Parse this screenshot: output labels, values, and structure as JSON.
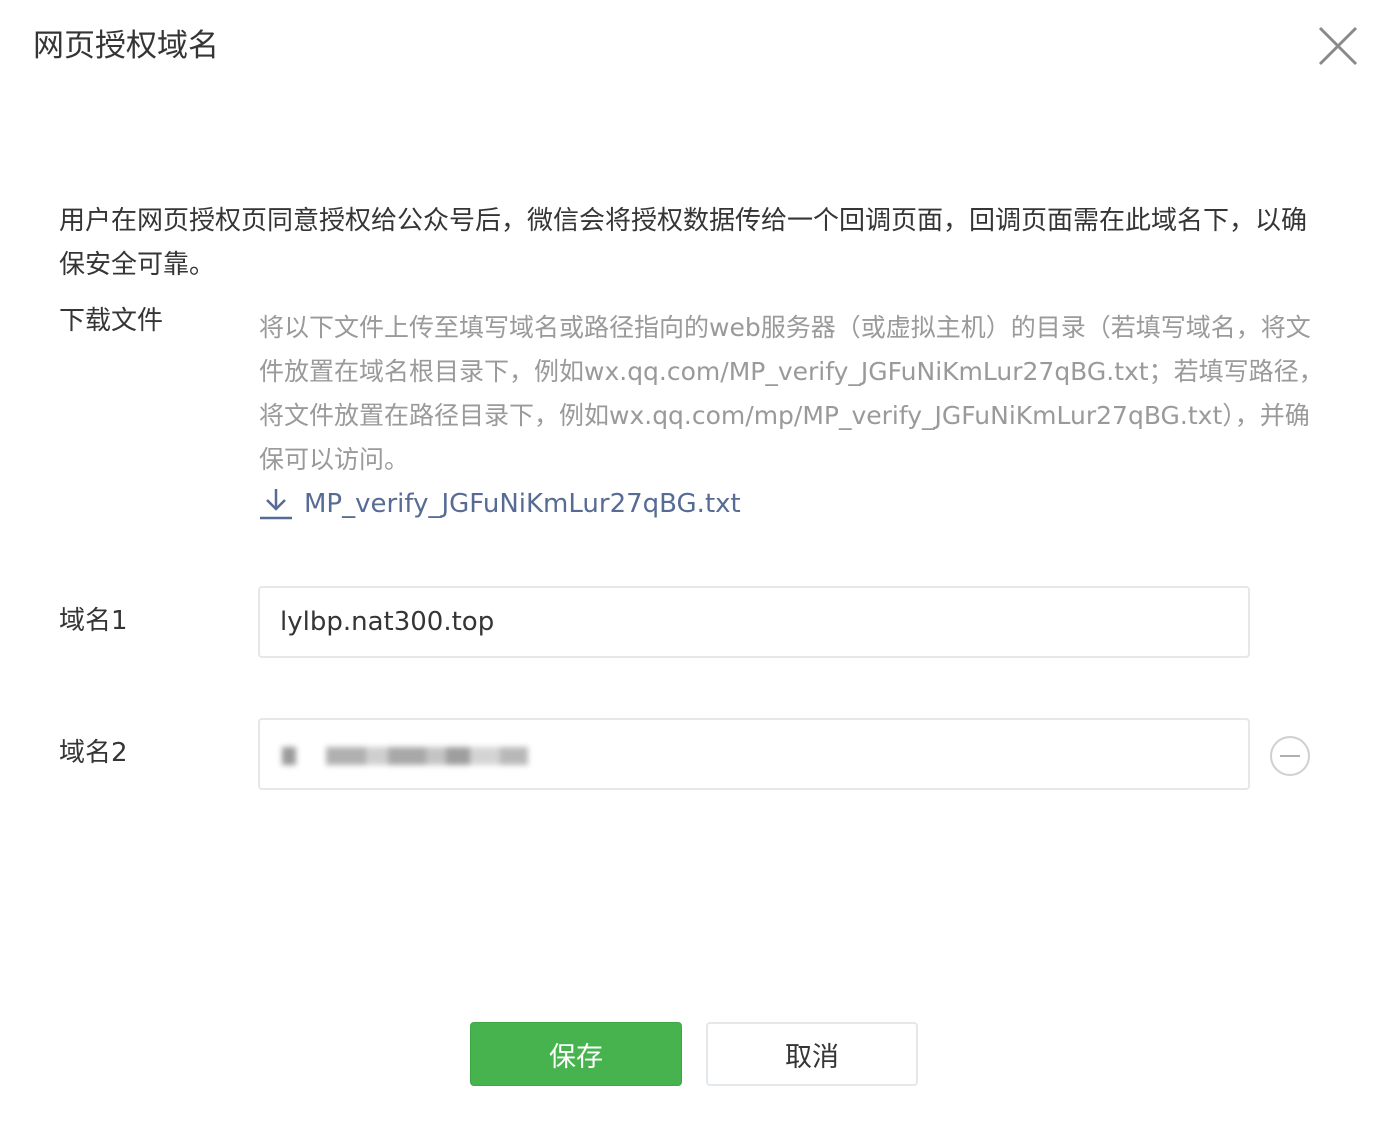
{
  "dialog": {
    "title": "网页授权域名",
    "close_icon": "close-icon"
  },
  "intro_text": "用户在网页授权页同意授权给公众号后，微信会将授权数据传给一个回调页面，回调页面需在此域名下，以确保安全可靠。",
  "download": {
    "label": "下载文件",
    "instructions": "将以下文件上传至填写域名或路径指向的web服务器（或虚拟主机）的目录（若填写域名，将文件放置在域名根目录下，例如wx.qq.com/MP_verify_JGFuNiKmLur27qBG.txt；若填写路径，将文件放置在路径目录下，例如wx.qq.com/mp/MP_verify_JGFuNiKmLur27qBG.txt），并确保可以访问。",
    "file_name": "MP_verify_JGFuNiKmLur27qBG.txt",
    "icon": "download-icon"
  },
  "domains": [
    {
      "label": "域名1",
      "value": "lylbp.nat300.top"
    },
    {
      "label": "域名2",
      "value": "",
      "remove_icon": "minus-circle-icon"
    }
  ],
  "buttons": {
    "save_label": "保存",
    "cancel_label": "取消"
  },
  "colors": {
    "primary": "#46b34f",
    "link": "#576b95",
    "muted_text": "#9a9a9a",
    "text": "#353535",
    "border": "#e4e8eb"
  }
}
